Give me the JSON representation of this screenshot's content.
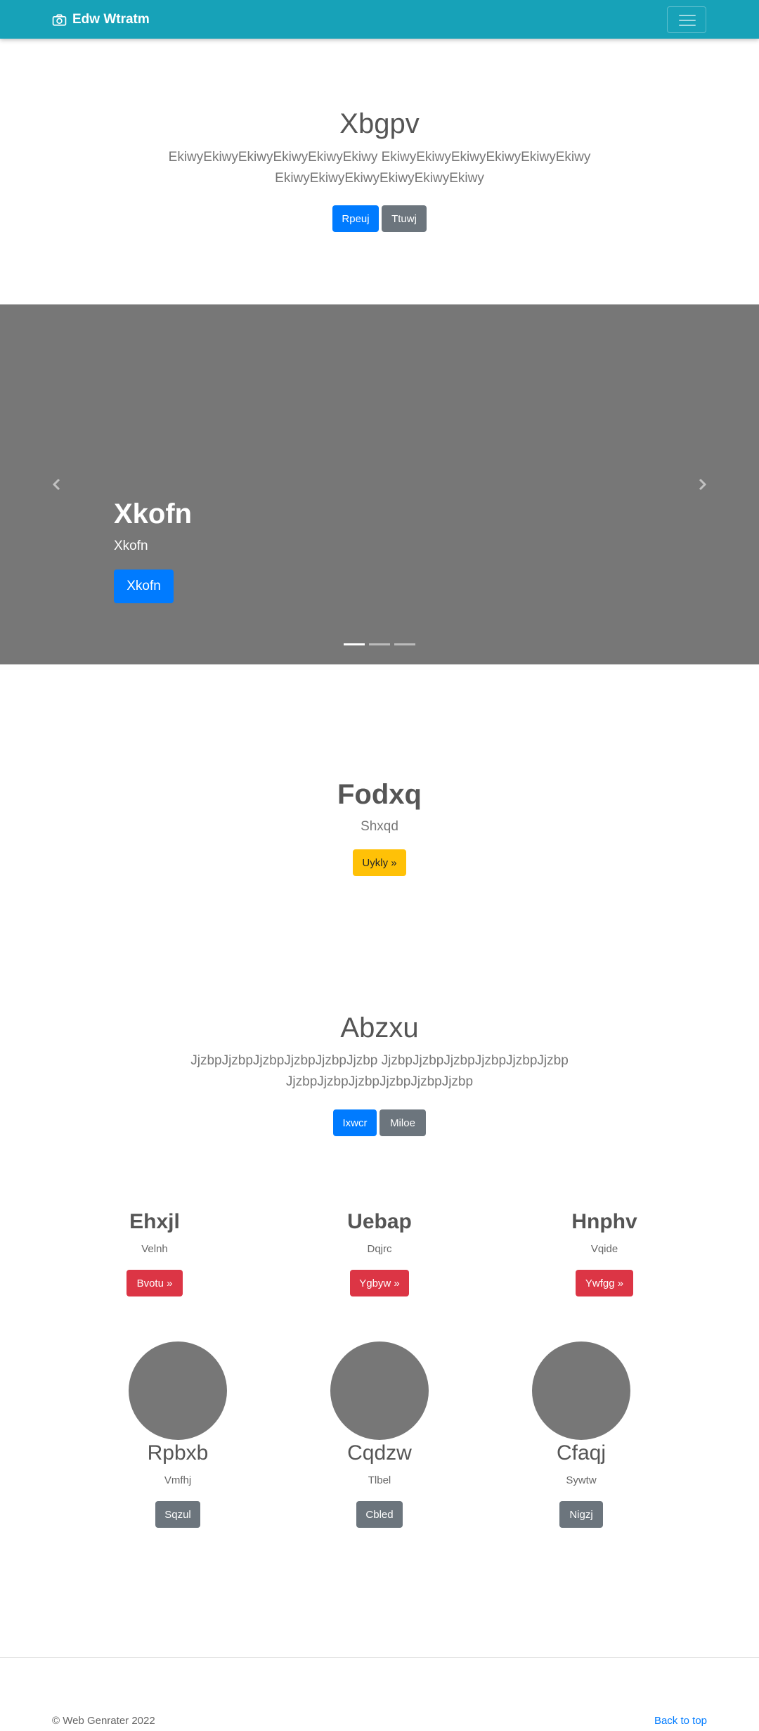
{
  "navbar": {
    "brand": "Edw Wtratm",
    "brand_icon": "camera-icon",
    "toggler_icon": "hamburger-icon",
    "background": "#17a2b8"
  },
  "hero": {
    "title": "Xbgpv",
    "lead_line1": "EkiwyEkiwyEkiwyEkiwyEkiwyEkiwy EkiwyEkiwyEkiwyEkiwyEkiwyEkiwy",
    "lead_line2": "EkiwyEkiwyEkiwyEkiwyEkiwyEkiwy",
    "primary_button": "Rpeuj",
    "secondary_button": "Ttuwj"
  },
  "carousel": {
    "caption_title": "Xkofn",
    "caption_text": "Xkofn",
    "caption_button": "Xkofn",
    "prev_icon": "chevron-left-icon",
    "next_icon": "chevron-right-icon",
    "slides": 3,
    "active_slide": 1
  },
  "feature": {
    "title": "Fodxq",
    "subtitle": "Shxqd",
    "button": "Uykly »"
  },
  "section2": {
    "title": "Abzxu",
    "lead_line1": "JjzbpJjzbpJjzbpJjzbpJjzbpJjzbp JjzbpJjzbpJjzbpJjzbpJjzbpJjzbp",
    "lead_line2": "JjzbpJjzbpJjzbpJjzbpJjzbpJjzbp",
    "primary_button": "Ixwcr",
    "secondary_button": "Miloe"
  },
  "columns": [
    {
      "title": "Ehxjl",
      "text": "Velnh",
      "button": "Bvotu »"
    },
    {
      "title": "Uebap",
      "text": "Dqjrc",
      "button": "Ygbyw »"
    },
    {
      "title": "Hnphv",
      "text": "Vqide",
      "button": "Ywfgg »"
    }
  ],
  "team": [
    {
      "name": "Rpbxb",
      "text": "Vmfhj",
      "button": "Sqzul"
    },
    {
      "name": "Cqdzw",
      "text": "Tlbel",
      "button": "Cbled"
    },
    {
      "name": "Cfaqj",
      "text": "Sywtw",
      "button": "Nigzj"
    }
  ],
  "footer": {
    "copyright": "© Web Genrater 2022",
    "back_to_top": "Back to top"
  }
}
